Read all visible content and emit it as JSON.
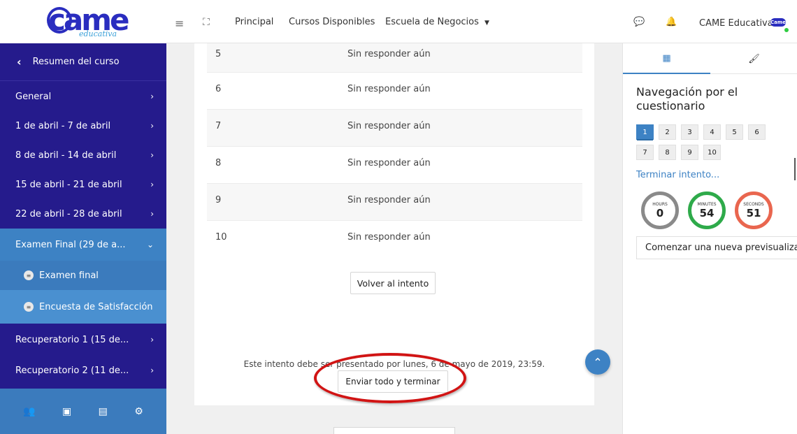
{
  "logo": {
    "text": "came",
    "sub": "educativa"
  },
  "sidebar": {
    "back": {
      "label": "Resumen del curso"
    },
    "items": [
      {
        "label": "General"
      },
      {
        "label": "1 de abril - 7 de abril"
      },
      {
        "label": "8 de abril - 14 de abril"
      },
      {
        "label": "15 de abril - 21 de abril"
      },
      {
        "label": "22 de abril - 28 de abril"
      },
      {
        "label": "Examen Final (29 de a..."
      }
    ],
    "subitems": [
      {
        "label": "Examen final"
      },
      {
        "label": "Encuesta de Satisfacción"
      }
    ],
    "items_after": [
      {
        "label": "Recuperatorio 1 (15 de..."
      },
      {
        "label": "Recuperatorio 2 (11 de..."
      }
    ],
    "footer_icons": [
      "users-icon",
      "archive-icon",
      "file-icon",
      "settings-icon"
    ]
  },
  "header": {
    "nav": [
      "Principal",
      "Cursos Disponibles",
      "Escuela de Negocios"
    ],
    "user_name": "CAME Educativa",
    "avatar_text": "Came"
  },
  "questions": [
    {
      "num": "5",
      "status": "Sin responder aún"
    },
    {
      "num": "6",
      "status": "Sin responder aún"
    },
    {
      "num": "7",
      "status": "Sin responder aún"
    },
    {
      "num": "8",
      "status": "Sin responder aún"
    },
    {
      "num": "9",
      "status": "Sin responder aún"
    },
    {
      "num": "10",
      "status": "Sin responder aún"
    }
  ],
  "main": {
    "return_button": "Volver al intento",
    "deadline": "Este intento debe ser presentado por lunes, 6 de mayo de 2019, 23:59.",
    "submit_button": "Enviar todo y terminar"
  },
  "right_panel": {
    "title": "Navegación por el cuestionario",
    "questions": [
      "1",
      "2",
      "3",
      "4",
      "5",
      "6",
      "7",
      "8",
      "9",
      "10"
    ],
    "current_question": "1",
    "finish_link": "Terminar intento...",
    "timer": {
      "hours": {
        "label": "HOURS",
        "value": "0"
      },
      "minutes": {
        "label": "MINUTES",
        "value": "54"
      },
      "seconds": {
        "label": "SECONDS",
        "value": "51"
      }
    },
    "preview_button": "Comenzar una nueva previsualización"
  },
  "colors": {
    "sidebar": "#251b8c",
    "active": "#3d82c4",
    "highlight": "#d11414"
  }
}
